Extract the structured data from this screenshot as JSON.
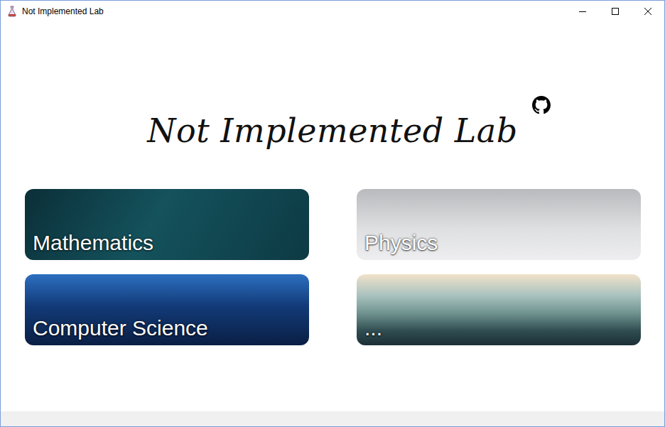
{
  "window": {
    "title": "Not Implemented Lab"
  },
  "header": {
    "title": "Not Implemented Lab"
  },
  "cards": [
    {
      "label": "Mathematics"
    },
    {
      "label": "Physics"
    },
    {
      "label": "Computer Science"
    },
    {
      "label": "..."
    }
  ]
}
